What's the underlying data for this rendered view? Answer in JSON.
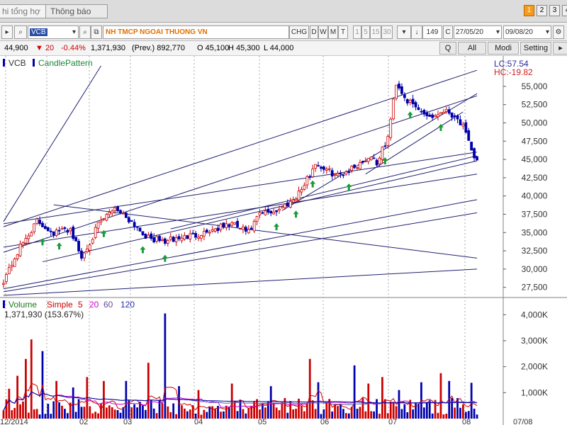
{
  "tabs": [
    {
      "label": "hi tổng hợ",
      "active": true
    },
    {
      "label": "Thông báo",
      "active": false
    }
  ],
  "window_buttons": [
    "1",
    "2",
    "3",
    "4"
  ],
  "toolbar": {
    "symbol": "VCB",
    "company": "NH TMCP NGOAI THUONG VN",
    "chg_label": "CHG",
    "periods": [
      "D",
      "W",
      "M",
      "T"
    ],
    "minutes": [
      "1",
      "5",
      "15",
      "30"
    ],
    "bars": "149",
    "c_label": "C",
    "date_from": "27/05/20",
    "date_to": "09/08/20"
  },
  "quote": {
    "price": "44,900",
    "change": "▼ 20",
    "pct": "-0.44%",
    "volume": "1,371,930",
    "prev": "(Prev.) 892,770",
    "open": "O 45,100",
    "high": "H 45,300",
    "low": "L 44,000"
  },
  "right_buttons": [
    "Q",
    "All",
    "Modi",
    "Setting"
  ],
  "colors": {
    "up": "#cc0000",
    "down": "#0000aa",
    "line": "#202070",
    "arrow": "#1a9a3a",
    "accent": "#e07000"
  },
  "chart_data": {
    "type": "candlestick",
    "panel_legend": {
      "symbol": "VCB",
      "indicator": "CandlePattern"
    },
    "lc_label": "LC:57.54",
    "hc_label": "HC:-19.82",
    "y_ticks": [
      55000,
      52500,
      50000,
      47500,
      45000,
      42500,
      40000,
      37500,
      35000,
      32500,
      30000,
      27500
    ],
    "y_tick_labels": [
      "55,000",
      "52,500",
      "50,000",
      "47,500",
      "45,000",
      "42,500",
      "40,000",
      "37,500",
      "35,000",
      "32,500",
      "30,000",
      "27,500"
    ],
    "ylim": [
      26500,
      57800
    ],
    "x_labels": [
      "12/2014",
      "02",
      "03",
      "04",
      "05",
      "06",
      "07",
      "08",
      "07/08"
    ],
    "closes_keypoints": [
      [
        0,
        28500
      ],
      [
        6,
        33000
      ],
      [
        12,
        36500
      ],
      [
        18,
        35000
      ],
      [
        24,
        35500
      ],
      [
        28,
        31500
      ],
      [
        34,
        36000
      ],
      [
        40,
        38500
      ],
      [
        46,
        36500
      ],
      [
        52,
        34200
      ],
      [
        58,
        33800
      ],
      [
        64,
        34300
      ],
      [
        70,
        34800
      ],
      [
        76,
        35500
      ],
      [
        82,
        36200
      ],
      [
        88,
        35000
      ],
      [
        92,
        37500
      ],
      [
        98,
        38000
      ],
      [
        104,
        39500
      ],
      [
        108,
        41500
      ],
      [
        112,
        44500
      ],
      [
        116,
        43500
      ],
      [
        120,
        42800
      ],
      [
        126,
        44000
      ],
      [
        132,
        45500
      ],
      [
        134,
        44500
      ],
      [
        138,
        48000
      ],
      [
        141,
        55500
      ],
      [
        145,
        53000
      ],
      [
        150,
        51500
      ],
      [
        154,
        50800
      ],
      [
        158,
        51800
      ],
      [
        162,
        51000
      ],
      [
        165,
        49500
      ],
      [
        168,
        46000
      ],
      [
        170,
        44900
      ]
    ],
    "pattern_arrow_bars": [
      14,
      20,
      36,
      50,
      58,
      98,
      105,
      111,
      124,
      137,
      146,
      157
    ],
    "volume": {
      "legend": {
        "name": "Volume",
        "ma_type": "Simple",
        "periods": [
          "5",
          "20",
          "60",
          "120"
        ]
      },
      "value_label": "1,371,930 (153.67%)",
      "y_ticks": [
        1000,
        2000,
        3000,
        4000
      ],
      "y_tick_labels": [
        "1,000K",
        "2,000K",
        "3,000K",
        "4,000K"
      ],
      "ylim": [
        0,
        4500
      ],
      "spikes": [
        [
          2,
          1150
        ],
        [
          5,
          1650
        ],
        [
          8,
          2300
        ],
        [
          10,
          3050
        ],
        [
          14,
          2600
        ],
        [
          19,
          1450
        ],
        [
          25,
          1200
        ],
        [
          30,
          1600
        ],
        [
          36,
          1450
        ],
        [
          44,
          1450
        ],
        [
          52,
          2150
        ],
        [
          58,
          4050
        ],
        [
          63,
          1250
        ],
        [
          70,
          1100
        ],
        [
          82,
          1350
        ],
        [
          96,
          1250
        ],
        [
          110,
          2300
        ],
        [
          113,
          1400
        ],
        [
          126,
          2050
        ],
        [
          131,
          1350
        ],
        [
          136,
          1600
        ],
        [
          142,
          1100
        ],
        [
          150,
          1400
        ],
        [
          157,
          1750
        ],
        [
          160,
          1450
        ],
        [
          168,
          1380
        ]
      ]
    }
  }
}
